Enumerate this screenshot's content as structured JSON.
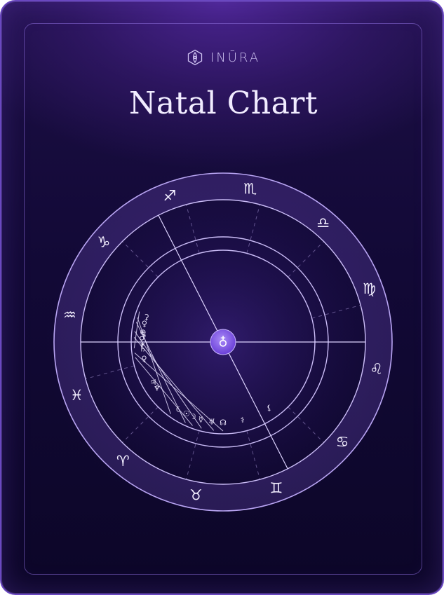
{
  "brand": {
    "name": "INŪRA",
    "icon": "inura-logo-icon"
  },
  "title": "Natal Chart",
  "colors": {
    "background_top": "#4a2490",
    "background_bottom": "#0c0628",
    "accent": "#8a5cf0",
    "line": "#d8ccff"
  },
  "chart_data": {
    "type": "natal-chart",
    "center_symbol": "♁",
    "zodiac_signs": [
      {
        "name": "scorpio",
        "symbol": "♏",
        "angle": -80
      },
      {
        "name": "libra",
        "symbol": "♎",
        "angle": -50
      },
      {
        "name": "virgo",
        "symbol": "♍",
        "angle": -20
      },
      {
        "name": "leo",
        "symbol": "♌",
        "angle": 10
      },
      {
        "name": "cancer",
        "symbol": "♋",
        "angle": 40
      },
      {
        "name": "gemini",
        "symbol": "♊",
        "angle": 70
      },
      {
        "name": "taurus",
        "symbol": "♉",
        "angle": 100
      },
      {
        "name": "aries",
        "symbol": "♈",
        "angle": 130
      },
      {
        "name": "pisces",
        "symbol": "♓",
        "angle": 160
      },
      {
        "name": "aquarius",
        "symbol": "♒",
        "angle": 190
      },
      {
        "name": "capricorn",
        "symbol": "♑",
        "angle": 220
      },
      {
        "name": "sagittarius",
        "symbol": "♐",
        "angle": 250
      }
    ],
    "planets": [
      {
        "name": "ceres",
        "symbol": "⚳",
        "angle": 198
      },
      {
        "name": "venus",
        "symbol": "♀",
        "angle": 193
      },
      {
        "name": "earth",
        "symbol": "⊕",
        "angle": 187
      },
      {
        "name": "mars",
        "symbol": "♂",
        "angle": 183
      },
      {
        "name": "star",
        "symbol": "✶",
        "angle": 178
      },
      {
        "name": "saturn",
        "symbol": "♄",
        "angle": 175
      },
      {
        "name": "venus-2",
        "symbol": "♀",
        "angle": 168
      },
      {
        "name": "jupiter",
        "symbol": "♃",
        "angle": 150
      },
      {
        "name": "neptune",
        "symbol": "♆",
        "angle": 145
      },
      {
        "name": "moon",
        "symbol": "☾",
        "angle": 123
      },
      {
        "name": "sun",
        "symbol": "☉",
        "angle": 117
      },
      {
        "name": "moon-2",
        "symbol": "☽",
        "angle": 112
      },
      {
        "name": "mercury",
        "symbol": "☿",
        "angle": 106
      },
      {
        "name": "uranus",
        "symbol": "♅",
        "angle": 98
      },
      {
        "name": "north-node",
        "symbol": "☊",
        "angle": 90
      },
      {
        "name": "hygiea",
        "symbol": "⚕",
        "angle": 76
      },
      {
        "name": "lilith",
        "symbol": "⚸",
        "angle": 55
      }
    ]
  }
}
